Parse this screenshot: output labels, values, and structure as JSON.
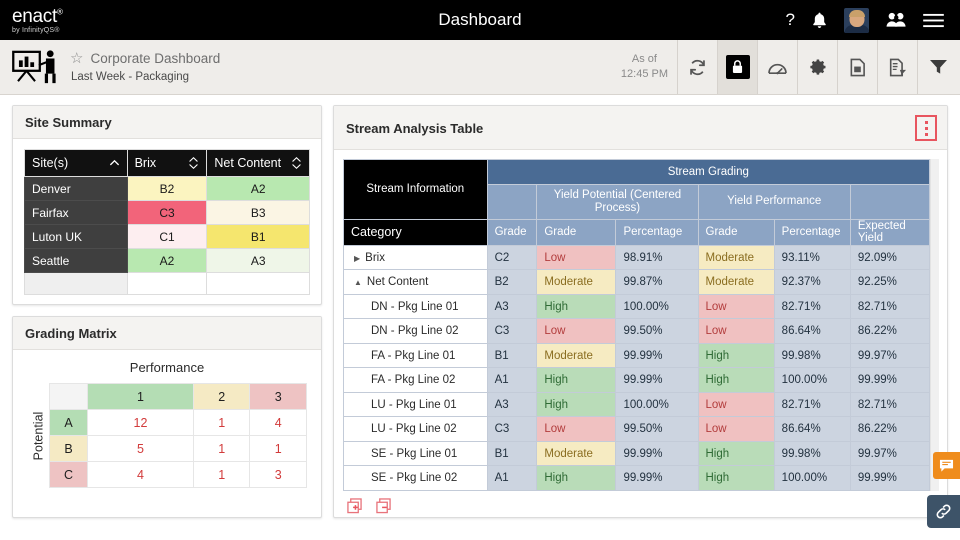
{
  "topbar": {
    "brand_name": "enact",
    "brand_tm": "®",
    "brand_sub": "by InfinityQS®",
    "title": "Dashboard",
    "icons": [
      {
        "name": "help-icon",
        "glyph": "?"
      },
      {
        "name": "notifications-bell-icon",
        "glyph": "🔔"
      },
      {
        "name": "user-avatar",
        "glyph": ""
      },
      {
        "name": "people-group-icon",
        "glyph": ""
      },
      {
        "name": "hamburger-menu-icon",
        "glyph": "☰"
      }
    ]
  },
  "toolbar": {
    "dashboard_icon": "presentation-board-icon",
    "favorite_star": "☆",
    "dashboard_name": "Corporate Dashboard",
    "dashboard_subtitle": "Last Week - Packaging",
    "as_of_label": "As of",
    "as_of_time": "12:45 PM",
    "buttons": [
      {
        "name": "refresh-button",
        "label": "Refresh",
        "active": false
      },
      {
        "name": "lock-button",
        "label": "Lock",
        "active": true
      },
      {
        "name": "gauge-button",
        "label": "Gauge",
        "active": false
      },
      {
        "name": "settings-gear-button",
        "label": "Settings",
        "active": false
      },
      {
        "name": "document-button",
        "label": "Document",
        "active": false
      },
      {
        "name": "report-export-button",
        "label": "Export Report",
        "active": false
      },
      {
        "name": "filter-button",
        "label": "Filter",
        "active": false
      }
    ]
  },
  "site_summary": {
    "title": "Site Summary",
    "columns": [
      {
        "label": "Site(s)",
        "sort": "asc"
      },
      {
        "label": "Brix",
        "sort": "none"
      },
      {
        "label": "Net Content",
        "sort": "none"
      }
    ],
    "rows": [
      {
        "site": "Denver",
        "brix": "B2",
        "brix_color": "#fbf4c0",
        "net": "A2",
        "net_color": "#b8e8b0"
      },
      {
        "site": "Fairfax",
        "brix": "C3",
        "brix_color": "#f2647a",
        "net": "B3",
        "net_color": "#fbf5e4"
      },
      {
        "site": "Luton UK",
        "brix": "C1",
        "brix_color": "#fdeef0",
        "net": "B1",
        "net_color": "#f5e66e"
      },
      {
        "site": "Seattle",
        "brix": "A2",
        "brix_color": "#b8e8b0",
        "net": "A3",
        "net_color": "#eff6e8"
      }
    ]
  },
  "grading_matrix": {
    "title": "Grading Matrix",
    "x_axis_label": "Performance",
    "y_axis_label": "Potential",
    "col_headers": [
      {
        "label": "1",
        "color": "#b4ddb4"
      },
      {
        "label": "2",
        "color": "#f5eac4"
      },
      {
        "label": "3",
        "color": "#eec3c3"
      }
    ],
    "row_headers": [
      {
        "label": "A",
        "color": "#b4ddb4"
      },
      {
        "label": "B",
        "color": "#f5eac4"
      },
      {
        "label": "C",
        "color": "#eec3c3"
      }
    ],
    "counts": [
      [
        "12",
        "1",
        "4"
      ],
      [
        "5",
        "1",
        "1"
      ],
      [
        "4",
        "1",
        "3"
      ]
    ]
  },
  "stream_analysis": {
    "title": "Stream Analysis Table",
    "kebab_menu": "more-options",
    "header": {
      "stream_information": "Stream Information",
      "stream_grading": "Stream Grading",
      "yield_potential": "Yield Potential (Centered Process)",
      "yield_performance": "Yield Performance",
      "category": "Category",
      "grade": "Grade",
      "percentage": "Percentage",
      "expected_yield": "Expected Yield"
    },
    "rows": [
      {
        "category": "Brix",
        "level": 1,
        "toggle": "collapsed",
        "grade": "C2",
        "yp_grade": "Low",
        "yp_class": "low",
        "yp_pct": "98.91%",
        "perf_grade": "Moderate",
        "perf_class": "mod",
        "perf_pct": "93.11%",
        "expected": "92.09%"
      },
      {
        "category": "Net Content",
        "level": 1,
        "toggle": "expanded",
        "grade": "B2",
        "yp_grade": "Moderate",
        "yp_class": "mod",
        "yp_pct": "99.87%",
        "perf_grade": "Moderate",
        "perf_class": "mod",
        "perf_pct": "92.37%",
        "expected": "92.25%"
      },
      {
        "category": "DN - Pkg Line 01",
        "level": 2,
        "toggle": "none",
        "grade": "A3",
        "yp_grade": "High",
        "yp_class": "high",
        "yp_pct": "100.00%",
        "perf_grade": "Low",
        "perf_class": "low",
        "perf_pct": "82.71%",
        "expected": "82.71%"
      },
      {
        "category": "DN - Pkg Line 02",
        "level": 2,
        "toggle": "none",
        "grade": "C3",
        "yp_grade": "Low",
        "yp_class": "low",
        "yp_pct": "99.50%",
        "perf_grade": "Low",
        "perf_class": "low",
        "perf_pct": "86.64%",
        "expected": "86.22%"
      },
      {
        "category": "FA - Pkg Line 01",
        "level": 2,
        "toggle": "none",
        "grade": "B1",
        "yp_grade": "Moderate",
        "yp_class": "mod",
        "yp_pct": "99.99%",
        "perf_grade": "High",
        "perf_class": "high",
        "perf_pct": "99.98%",
        "expected": "99.97%"
      },
      {
        "category": "FA - Pkg Line 02",
        "level": 2,
        "toggle": "none",
        "grade": "A1",
        "yp_grade": "High",
        "yp_class": "high",
        "yp_pct": "99.99%",
        "perf_grade": "High",
        "perf_class": "high",
        "perf_pct": "100.00%",
        "expected": "99.99%"
      },
      {
        "category": "LU - Pkg Line 01",
        "level": 2,
        "toggle": "none",
        "grade": "A3",
        "yp_grade": "High",
        "yp_class": "high",
        "yp_pct": "100.00%",
        "perf_grade": "Low",
        "perf_class": "low",
        "perf_pct": "82.71%",
        "expected": "82.71%"
      },
      {
        "category": "LU - Pkg Line 02",
        "level": 2,
        "toggle": "none",
        "grade": "C3",
        "yp_grade": "Low",
        "yp_class": "low",
        "yp_pct": "99.50%",
        "perf_grade": "Low",
        "perf_class": "low",
        "perf_pct": "86.64%",
        "expected": "86.22%"
      },
      {
        "category": "SE - Pkg Line 01",
        "level": 2,
        "toggle": "none",
        "grade": "B1",
        "yp_grade": "Moderate",
        "yp_class": "mod",
        "yp_pct": "99.99%",
        "perf_grade": "High",
        "perf_class": "high",
        "perf_pct": "99.98%",
        "expected": "99.97%"
      },
      {
        "category": "SE - Pkg Line 02",
        "level": 2,
        "toggle": "none",
        "grade": "A1",
        "yp_grade": "High",
        "yp_class": "high",
        "yp_pct": "99.99%",
        "perf_grade": "High",
        "perf_class": "high",
        "perf_pct": "100.00%",
        "expected": "99.99%"
      }
    ],
    "footer_controls": [
      {
        "name": "expand-all-button",
        "glyph": "+"
      },
      {
        "name": "collapse-all-button",
        "glyph": "−"
      }
    ]
  },
  "floating": {
    "chat_button": "chat-icon",
    "link_button": "link-icon"
  },
  "colors": {
    "accent_red": "#e8555f",
    "header_blue": "#4a6b94",
    "subheader_blue": "#8ca4c4",
    "grade_cell": "#ccd4e0",
    "low": "#f0c1c1",
    "moderate": "#f6ebc2",
    "high": "#b9dcb8",
    "chat_orange": "#ef8c1c",
    "link_blue": "#3d5368"
  }
}
